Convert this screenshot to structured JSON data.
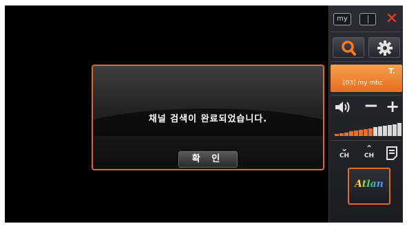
{
  "dialog": {
    "message": "채널 검색이 완료되었습니다.",
    "ok_label": "확 인"
  },
  "panel": {
    "my_label": "my",
    "channel": {
      "label": "[03] my mbc"
    },
    "volume": {
      "level": 0.6,
      "segments": 14
    },
    "ch_down_label": "CH",
    "ch_up_label": "CH",
    "app_label": "Atlan"
  },
  "icons": {
    "close": "close-icon",
    "search": "search-icon",
    "settings": "gear-icon",
    "volume": "speaker-icon",
    "signal": "antenna-icon",
    "epg": "guide-icon"
  },
  "colors": {
    "accent": "#e8742a",
    "close": "#ff3b1f",
    "background": "#000000",
    "panel": "#25262b"
  }
}
